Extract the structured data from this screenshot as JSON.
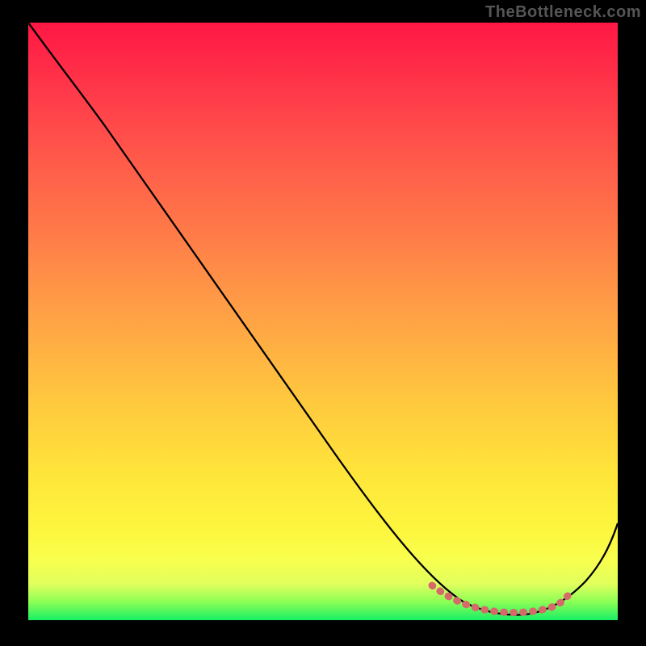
{
  "watermark": "TheBottleneck.com",
  "chart_data": {
    "type": "line",
    "title": "",
    "xlabel": "",
    "ylabel": "",
    "xlim": [
      0,
      100
    ],
    "ylim": [
      0,
      100
    ],
    "gradient_stops": [
      {
        "offset": 0,
        "color": "#ff1744"
      },
      {
        "offset": 12,
        "color": "#ff3a4a"
      },
      {
        "offset": 23,
        "color": "#ff5a4a"
      },
      {
        "offset": 36,
        "color": "#ff7d48"
      },
      {
        "offset": 50,
        "color": "#ffa445"
      },
      {
        "offset": 64,
        "color": "#ffca3e"
      },
      {
        "offset": 76,
        "color": "#ffe63a"
      },
      {
        "offset": 85,
        "color": "#fdf63e"
      },
      {
        "offset": 90,
        "color": "#f8ff4e"
      },
      {
        "offset": 94,
        "color": "#e0ff5d"
      },
      {
        "offset": 97,
        "color": "#8aff55"
      },
      {
        "offset": 100,
        "color": "#18ef66"
      }
    ],
    "series": [
      {
        "name": "bottleneck-curve",
        "x": [
          0,
          7,
          15,
          25,
          35,
          45,
          55,
          65,
          72,
          77,
          80,
          83,
          87,
          90,
          94,
          100
        ],
        "y": [
          100,
          92,
          83,
          71,
          59,
          47,
          35,
          23,
          14,
          7,
          3,
          1,
          1,
          3,
          9,
          22
        ]
      },
      {
        "name": "optimal-band",
        "x": [
          70,
          73,
          76,
          79,
          82,
          85,
          88,
          91
        ],
        "y": [
          6,
          4,
          3,
          2,
          2,
          2,
          3,
          5
        ]
      }
    ]
  }
}
